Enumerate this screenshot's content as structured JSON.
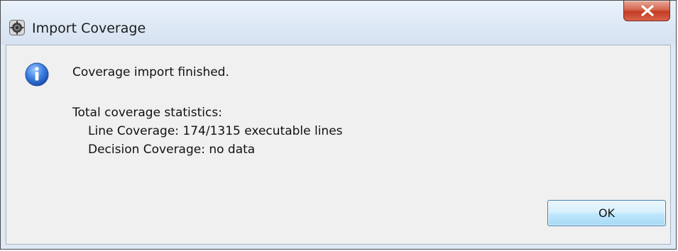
{
  "window": {
    "title": "Import Coverage",
    "app_icon": "eclipse-gear-icon",
    "close_icon": "close-icon"
  },
  "dialog": {
    "icon": "info-icon",
    "message": "Coverage import finished.",
    "stats_heading": "Total coverage statistics:",
    "line_coverage": "Line Coverage: 174/1315 executable lines",
    "decision_coverage": "Decision Coverage: no data"
  },
  "buttons": {
    "ok_label": "OK"
  },
  "colors": {
    "close_button": "#c33d24",
    "info_icon": "#2f6fd1",
    "ok_border": "#3c7fb1"
  }
}
